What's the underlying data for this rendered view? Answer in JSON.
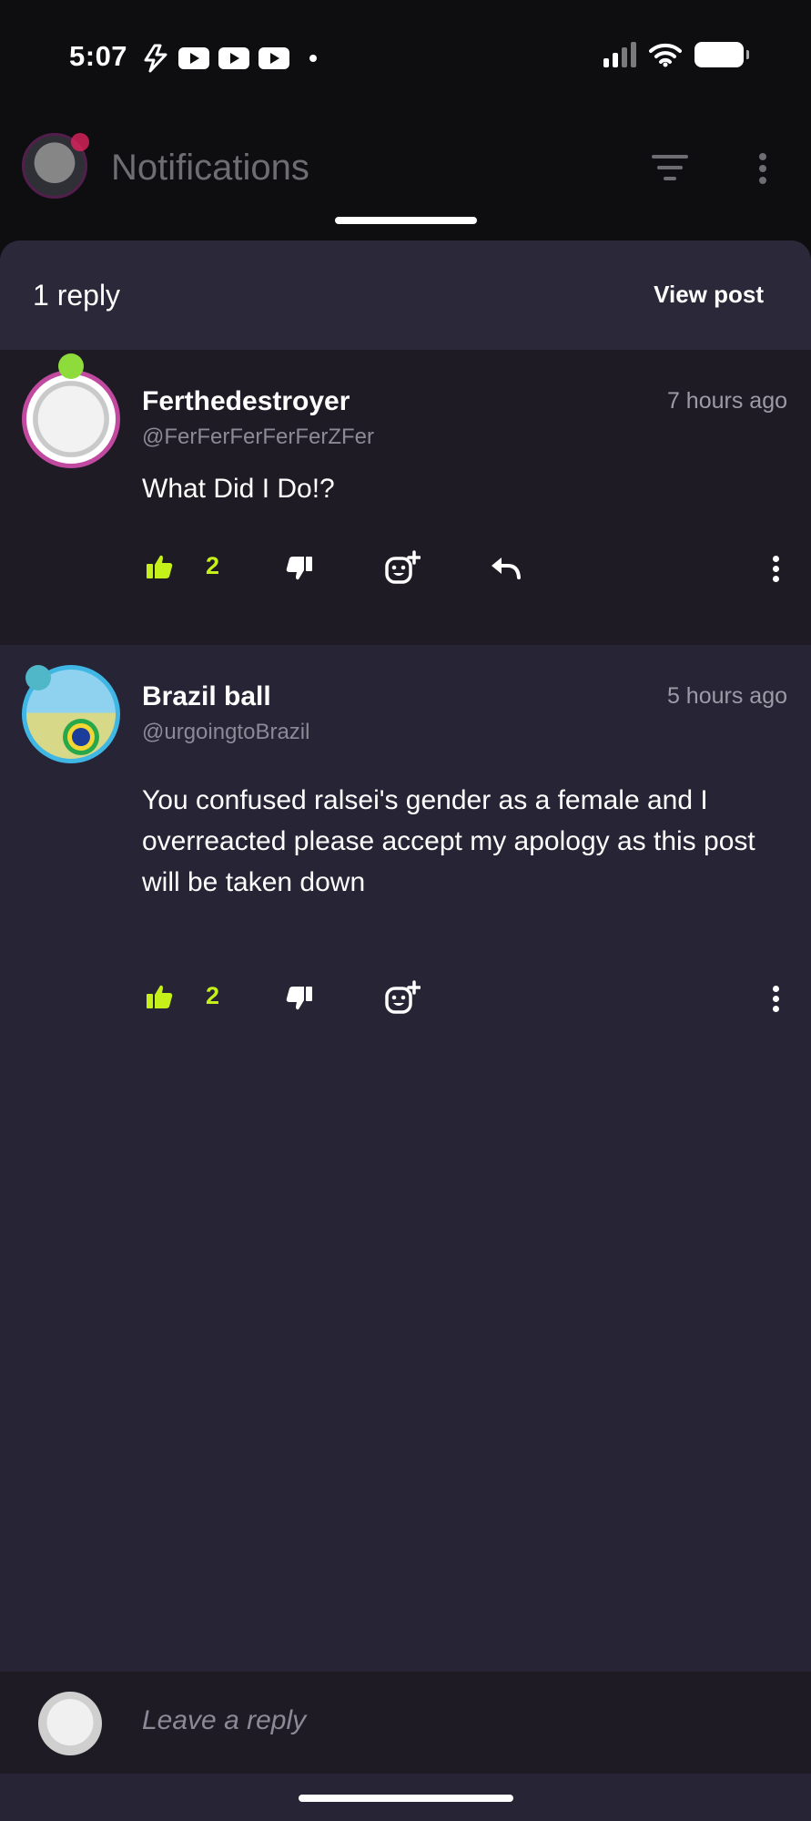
{
  "status_bar": {
    "time": "5:07",
    "left_icons": [
      "flash-icon",
      "youtube-icon",
      "youtube-icon",
      "youtube-icon",
      "dot-icon"
    ],
    "right_icons": [
      "signal-icon",
      "wifi-icon",
      "battery-icon"
    ]
  },
  "app_bar": {
    "title": "Notifications",
    "icons": [
      "filter-icon",
      "more-vertical-icon"
    ]
  },
  "sheet": {
    "reply_count": "1 reply",
    "view_post_label": "View post"
  },
  "comments": [
    {
      "username": "Ferthedestroyer",
      "handle": "@FerFerFerFerFerZFer",
      "timestamp": "7 hours ago",
      "body": "What Did I Do!?",
      "likes": "2"
    },
    {
      "username": "Brazil ball",
      "handle": "@urgoingtoBrazil",
      "timestamp": "5 hours ago",
      "body": "You confused ralsei's gender as a female and I overreacted please accept my apology as this post will be taken down",
      "likes": "2"
    }
  ],
  "composer": {
    "placeholder": "Leave a reply"
  },
  "colors": {
    "like_accent": "#c5f019",
    "sheet_background": "#262435",
    "parent_background": "#1e1b24"
  }
}
